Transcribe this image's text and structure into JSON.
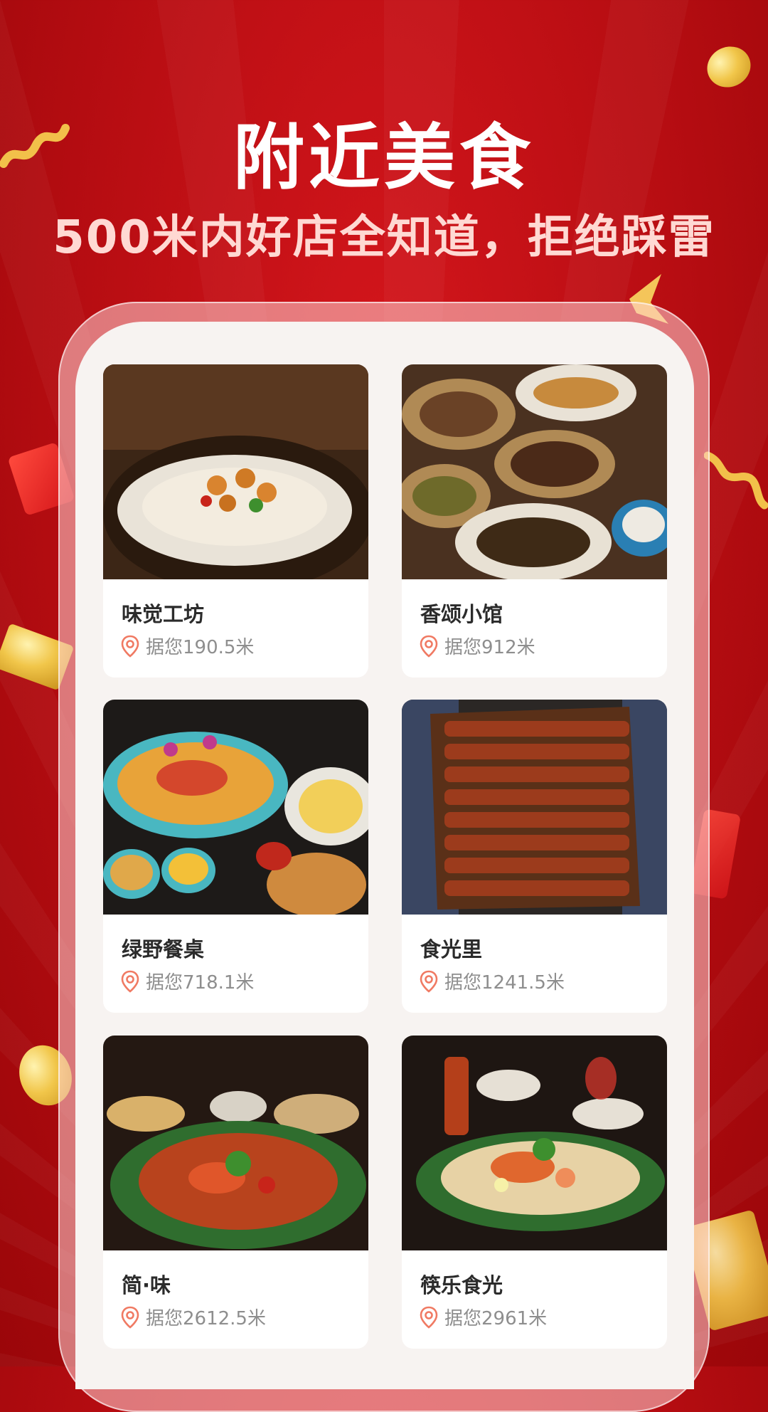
{
  "header": {
    "title": "附近美食",
    "subtitle": "500米内好店全知道，拒绝踩雷"
  },
  "colors": {
    "background": "#c1121a",
    "title_text": "#ffffff",
    "subtitle_text": "#ffd9d3",
    "pin": "#f07a63",
    "name_text": "#2b2b2b",
    "distance_text": "#8e8e8e"
  },
  "restaurants": [
    {
      "name": "味觉工坊",
      "distance": "据您190.5米",
      "photo": "chicken-noodle-plate"
    },
    {
      "name": "香颂小馆",
      "distance": "据您912米",
      "photo": "assorted-dishes-spread"
    },
    {
      "name": "绿野餐桌",
      "distance": "据您718.1米",
      "photo": "seafood-crab-feast"
    },
    {
      "name": "食光里",
      "distance": "据您1241.5米",
      "photo": "grilled-ribs"
    },
    {
      "name": "简·味",
      "distance": "据您2612.5米",
      "photo": "shrimp-curry-leaf"
    },
    {
      "name": "筷乐食光",
      "distance": "据您2961米",
      "photo": "pad-thai-shrimp"
    }
  ],
  "icons": {
    "pin": "location-pin-icon"
  }
}
